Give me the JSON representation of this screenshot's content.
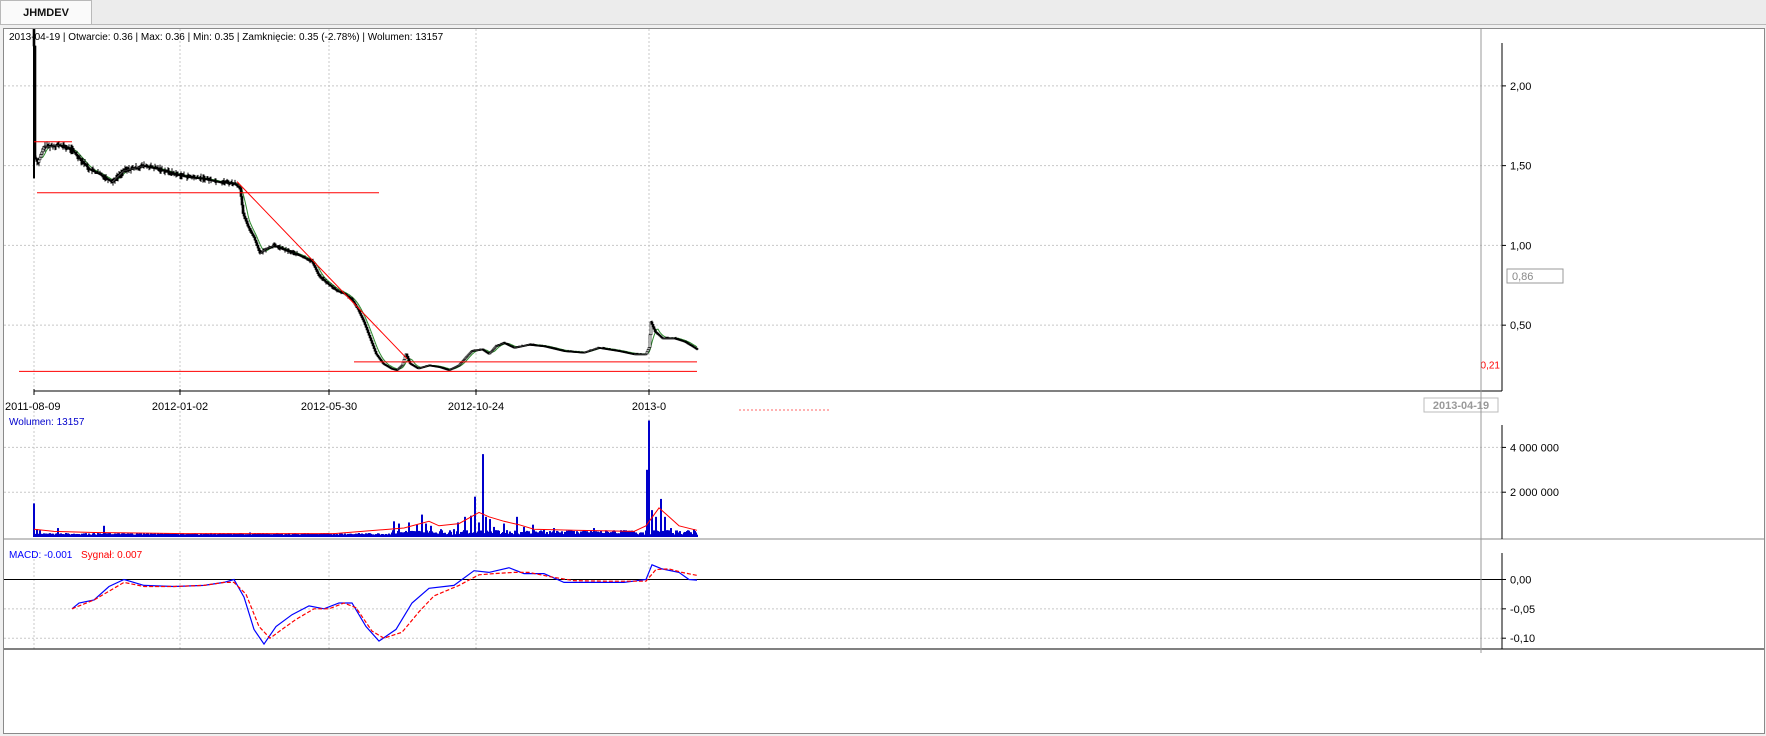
{
  "window": {
    "tab_label": "JHMDEV"
  },
  "header": {
    "info_text": "2013-04-19 | Otwarcie: 0.36 | Max: 0.36 | Min: 0.35 | Zamknięcie: 0.35 (-2.78%)  | Wolumen: 13157"
  },
  "price_axis": {
    "ticks": [
      {
        "value": 2.0,
        "label": "2,00"
      },
      {
        "value": 1.5,
        "label": "1,50"
      },
      {
        "value": 1.0,
        "label": "1,00"
      },
      {
        "value": 0.5,
        "label": "0,50"
      }
    ],
    "current_value_box": "0,86",
    "support_level_label": "0,21"
  },
  "time_axis": {
    "ticks": [
      {
        "day": 0,
        "label": "2011-08-09"
      },
      {
        "day": 146,
        "label": "2012-01-02"
      },
      {
        "day": 295,
        "label": "2012-05-30"
      },
      {
        "day": 442,
        "label": "2012-10-24"
      },
      {
        "day": 615,
        "label": "2013-0"
      }
    ],
    "current_date_label": "2013-04-19"
  },
  "volume_panel": {
    "label": "Wolumen: 13157",
    "ticks": [
      {
        "value": 4000000,
        "label": "4 000 000"
      },
      {
        "value": 2000000,
        "label": "2 000 000"
      }
    ]
  },
  "macd_panel": {
    "label_macd": "MACD: -0.001",
    "label_signal": "Sygnał: 0.007",
    "ticks": [
      {
        "value": 0.0,
        "label": "0,00"
      },
      {
        "value": -0.05,
        "label": "-0,05"
      },
      {
        "value": -0.1,
        "label": "-0,10"
      }
    ]
  },
  "colors": {
    "candle": "#000000",
    "moving_average": "#2e8b2e",
    "trend_lines": "#ff0000",
    "volume_bars": "#0000cc",
    "volume_average": "#ff0000",
    "macd_line": "#0000ff",
    "signal_line": "#ff0000",
    "grid": "#c8c8c8"
  },
  "chart_data": [
    {
      "type": "candlestick",
      "x_unit": "trading days since 2011-08-09",
      "ylim": [
        0.15,
        2.25
      ],
      "grid": true,
      "price_points": [
        [
          0,
          2.25
        ],
        [
          1,
          1.55
        ],
        [
          4,
          1.52
        ],
        [
          10,
          1.62
        ],
        [
          25,
          1.63
        ],
        [
          38,
          1.6
        ],
        [
          45,
          1.55
        ],
        [
          55,
          1.48
        ],
        [
          65,
          1.45
        ],
        [
          78,
          1.4
        ],
        [
          90,
          1.47
        ],
        [
          110,
          1.5
        ],
        [
          125,
          1.48
        ],
        [
          140,
          1.45
        ],
        [
          155,
          1.43
        ],
        [
          170,
          1.42
        ],
        [
          185,
          1.4
        ],
        [
          200,
          1.39
        ],
        [
          206,
          1.36
        ],
        [
          209,
          1.2
        ],
        [
          214,
          1.12
        ],
        [
          220,
          1.05
        ],
        [
          226,
          0.95
        ],
        [
          232,
          0.98
        ],
        [
          240,
          1.0
        ],
        [
          252,
          0.97
        ],
        [
          265,
          0.94
        ],
        [
          278,
          0.9
        ],
        [
          285,
          0.81
        ],
        [
          292,
          0.77
        ],
        [
          302,
          0.72
        ],
        [
          310,
          0.7
        ],
        [
          318,
          0.66
        ],
        [
          324,
          0.6
        ],
        [
          330,
          0.52
        ],
        [
          336,
          0.42
        ],
        [
          342,
          0.32
        ],
        [
          349,
          0.26
        ],
        [
          357,
          0.23
        ],
        [
          363,
          0.22
        ],
        [
          368,
          0.25
        ],
        [
          372,
          0.32
        ],
        [
          376,
          0.26
        ],
        [
          384,
          0.23
        ],
        [
          395,
          0.25
        ],
        [
          405,
          0.24
        ],
        [
          415,
          0.22
        ],
        [
          425,
          0.25
        ],
        [
          432,
          0.3
        ],
        [
          438,
          0.34
        ],
        [
          448,
          0.35
        ],
        [
          455,
          0.32
        ],
        [
          462,
          0.37
        ],
        [
          470,
          0.39
        ],
        [
          480,
          0.36
        ],
        [
          495,
          0.38
        ],
        [
          510,
          0.37
        ],
        [
          530,
          0.34
        ],
        [
          550,
          0.33
        ],
        [
          565,
          0.36
        ],
        [
          585,
          0.34
        ],
        [
          600,
          0.32
        ],
        [
          612,
          0.32
        ],
        [
          615,
          0.36
        ],
        [
          617,
          0.52
        ],
        [
          621,
          0.46
        ],
        [
          628,
          0.42
        ],
        [
          640,
          0.42
        ],
        [
          650,
          0.4
        ],
        [
          658,
          0.37
        ],
        [
          663,
          0.35
        ]
      ],
      "horizontal_lines": [
        {
          "from_day": 0,
          "to_day": 38,
          "value": 1.65
        },
        {
          "from_day": 3,
          "to_day": 345,
          "value": 1.33
        },
        {
          "from_day": 320,
          "to_day": 663,
          "value": 0.27
        },
        {
          "from_day": -15,
          "to_day": 663,
          "value": 0.21
        }
      ],
      "trend_lines": [
        {
          "from": [
            203,
            1.4
          ],
          "to": [
            373,
            0.29
          ]
        }
      ]
    },
    {
      "type": "bar",
      "title": "Wolumen: 13157",
      "ylim": [
        0,
        5000000
      ],
      "spikes": [
        [
          0,
          1500000
        ],
        [
          3,
          350000
        ],
        [
          6,
          300000
        ],
        [
          24,
          400000
        ],
        [
          70,
          500000
        ],
        [
          216,
          200000
        ],
        [
          360,
          700000
        ],
        [
          365,
          600000
        ],
        [
          375,
          650000
        ],
        [
          383,
          550000
        ],
        [
          388,
          1000000
        ],
        [
          392,
          600000
        ],
        [
          397,
          500000
        ],
        [
          407,
          350000
        ],
        [
          420,
          350000
        ],
        [
          424,
          650000
        ],
        [
          431,
          900000
        ],
        [
          437,
          950000
        ],
        [
          441,
          1800000
        ],
        [
          445,
          650000
        ],
        [
          449,
          3700000
        ],
        [
          452,
          900000
        ],
        [
          456,
          800000
        ],
        [
          460,
          450000
        ],
        [
          470,
          600000
        ],
        [
          483,
          900000
        ],
        [
          490,
          450000
        ],
        [
          499,
          550000
        ],
        [
          510,
          350000
        ],
        [
          520,
          400000
        ],
        [
          535,
          300000
        ],
        [
          560,
          400000
        ],
        [
          580,
          300000
        ],
        [
          600,
          250000
        ],
        [
          613,
          3000000
        ],
        [
          615,
          5200000
        ],
        [
          618,
          1200000
        ],
        [
          622,
          900000
        ],
        [
          627,
          1700000
        ],
        [
          631,
          900000
        ],
        [
          637,
          400000
        ],
        [
          660,
          350000
        ]
      ],
      "average_points": [
        [
          0,
          350000
        ],
        [
          20,
          250000
        ],
        [
          60,
          200000
        ],
        [
          150,
          150000
        ],
        [
          300,
          150000
        ],
        [
          355,
          350000
        ],
        [
          370,
          400000
        ],
        [
          395,
          700000
        ],
        [
          405,
          500000
        ],
        [
          425,
          600000
        ],
        [
          445,
          1100000
        ],
        [
          455,
          900000
        ],
        [
          470,
          700000
        ],
        [
          485,
          550000
        ],
        [
          500,
          350000
        ],
        [
          540,
          300000
        ],
        [
          600,
          250000
        ],
        [
          612,
          500000
        ],
        [
          625,
          1300000
        ],
        [
          635,
          900000
        ],
        [
          645,
          500000
        ],
        [
          663,
          300000
        ]
      ]
    },
    {
      "type": "line",
      "title": "MACD",
      "ylim": [
        -0.115,
        0.04
      ],
      "series": [
        {
          "name": "MACD",
          "points": [
            [
              38,
              -0.05
            ],
            [
              45,
              -0.04
            ],
            [
              60,
              -0.035
            ],
            [
              75,
              -0.012
            ],
            [
              90,
              0.0
            ],
            [
              110,
              -0.01
            ],
            [
              140,
              -0.012
            ],
            [
              170,
              -0.01
            ],
            [
              190,
              -0.005
            ],
            [
              200,
              0.0
            ],
            [
              210,
              -0.03
            ],
            [
              220,
              -0.085
            ],
            [
              230,
              -0.11
            ],
            [
              242,
              -0.08
            ],
            [
              258,
              -0.06
            ],
            [
              275,
              -0.045
            ],
            [
              290,
              -0.05
            ],
            [
              305,
              -0.04
            ],
            [
              318,
              -0.04
            ],
            [
              332,
              -0.08
            ],
            [
              345,
              -0.105
            ],
            [
              362,
              -0.085
            ],
            [
              378,
              -0.04
            ],
            [
              395,
              -0.015
            ],
            [
              420,
              -0.01
            ],
            [
              440,
              0.015
            ],
            [
              455,
              0.012
            ],
            [
              475,
              0.02
            ],
            [
              490,
              0.01
            ],
            [
              510,
              0.01
            ],
            [
              530,
              -0.005
            ],
            [
              560,
              -0.005
            ],
            [
              590,
              -0.005
            ],
            [
              612,
              0.0
            ],
            [
              618,
              0.025
            ],
            [
              628,
              0.018
            ],
            [
              645,
              0.012
            ],
            [
              655,
              0.0
            ],
            [
              663,
              -0.001
            ]
          ]
        },
        {
          "name": "Sygnał",
          "points": [
            [
              38,
              -0.05
            ],
            [
              45,
              -0.045
            ],
            [
              60,
              -0.035
            ],
            [
              75,
              -0.02
            ],
            [
              90,
              -0.005
            ],
            [
              110,
              -0.012
            ],
            [
              140,
              -0.012
            ],
            [
              170,
              -0.01
            ],
            [
              190,
              -0.005
            ],
            [
              200,
              -0.005
            ],
            [
              212,
              -0.025
            ],
            [
              225,
              -0.08
            ],
            [
              236,
              -0.1
            ],
            [
              248,
              -0.085
            ],
            [
              262,
              -0.068
            ],
            [
              280,
              -0.05
            ],
            [
              295,
              -0.05
            ],
            [
              310,
              -0.04
            ],
            [
              322,
              -0.048
            ],
            [
              338,
              -0.088
            ],
            [
              350,
              -0.1
            ],
            [
              368,
              -0.09
            ],
            [
              385,
              -0.055
            ],
            [
              400,
              -0.028
            ],
            [
              425,
              -0.01
            ],
            [
              445,
              0.008
            ],
            [
              460,
              0.01
            ],
            [
              480,
              0.012
            ],
            [
              495,
              0.012
            ],
            [
              515,
              0.005
            ],
            [
              540,
              -0.002
            ],
            [
              575,
              -0.003
            ],
            [
              612,
              -0.003
            ],
            [
              622,
              0.017
            ],
            [
              635,
              0.018
            ],
            [
              648,
              0.012
            ],
            [
              663,
              0.007
            ]
          ]
        }
      ]
    }
  ]
}
